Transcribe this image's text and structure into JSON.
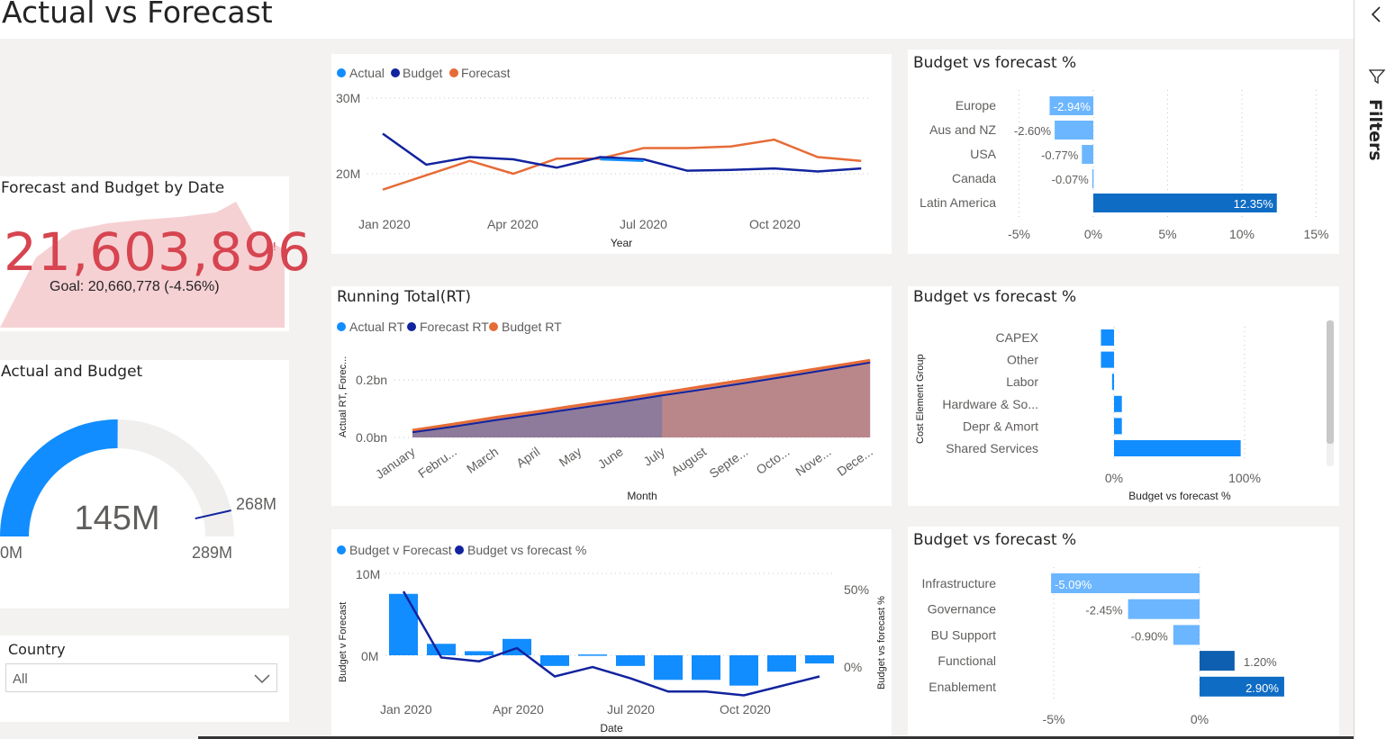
{
  "page_title": "Actual vs Forecast",
  "filters_label": "Filters",
  "icons": {
    "collapse": "chevron-left-icon",
    "filter": "filter-funnel-icon",
    "dropdown": "chevron-down-icon"
  },
  "colors": {
    "actual": "#118dff",
    "budget": "#12239e",
    "forecast": "#e66c37",
    "light_bar": "#6cb6ff",
    "dark_bar": "#0f6cc4",
    "kpi_red": "#d64550"
  },
  "kpi": {
    "title": "Forecast and Budget by Date",
    "value": "21,603,896",
    "indicator": "!",
    "goal": "Goal: 20,660,778 (-4.56%)"
  },
  "gauge": {
    "title": "Actual and Budget",
    "value_label": "145M",
    "min_label": "0M",
    "max_label": "289M",
    "target_label": "268M",
    "chart_data": {
      "type": "gauge",
      "value": 145,
      "min": 0,
      "max": 289,
      "target": 268,
      "unit": "M"
    }
  },
  "slicer": {
    "title": "Country",
    "value": "All"
  },
  "line_chart": {
    "legend": [
      "Actual",
      "Budget",
      "Forecast"
    ],
    "xlabel": "Year",
    "y_ticks": [
      "30M",
      "20M"
    ],
    "x_ticks": [
      "Jan 2020",
      "Apr 2020",
      "Jul 2020",
      "Oct 2020"
    ],
    "chart_data": {
      "type": "line",
      "x": [
        "2020-01",
        "2020-02",
        "2020-03",
        "2020-04",
        "2020-05",
        "2020-06",
        "2020-07",
        "2020-08",
        "2020-09",
        "2020-10",
        "2020-11",
        "2020-12"
      ],
      "ylim": [
        15,
        30
      ],
      "series": [
        {
          "name": "Actual",
          "values": [
            null,
            null,
            null,
            null,
            null,
            21.9,
            21.7,
            null,
            null,
            null,
            null,
            null
          ]
        },
        {
          "name": "Budget",
          "values": [
            25.3,
            21.2,
            22.2,
            21.9,
            20.8,
            22.2,
            21.9,
            20.4,
            20.5,
            20.7,
            20.3,
            20.7
          ]
        },
        {
          "name": "Forecast",
          "values": [
            17.9,
            19.8,
            21.7,
            20.0,
            22.0,
            22.0,
            23.4,
            23.4,
            23.6,
            24.5,
            22.2,
            21.7
          ]
        }
      ]
    }
  },
  "running_total": {
    "title": "Running Total(RT)",
    "legend": [
      "Actual RT",
      "Forecast RT",
      "Budget RT"
    ],
    "xlabel": "Month",
    "ylabel": "Actual RT, Forec...",
    "y_ticks": [
      "0.2bn",
      "0.0bn"
    ],
    "x_ticks": [
      "January",
      "Febru...",
      "March",
      "April",
      "May",
      "June",
      "July",
      "August",
      "Septe...",
      "Octo...",
      "Nove...",
      "Dece..."
    ],
    "chart_data": {
      "type": "area",
      "categories": [
        "January",
        "February",
        "March",
        "April",
        "May",
        "June",
        "July",
        "August",
        "September",
        "October",
        "November",
        "December"
      ],
      "ylim": [
        0,
        0.3
      ],
      "series": [
        {
          "name": "Actual RT",
          "values": [
            0.02,
            0.04,
            0.06,
            0.08,
            0.1,
            0.12,
            0.145,
            null,
            null,
            null,
            null,
            null
          ]
        },
        {
          "name": "Forecast RT",
          "values": [
            0.018,
            0.038,
            0.06,
            0.081,
            0.102,
            0.123,
            0.146,
            0.167,
            0.189,
            0.212,
            0.236,
            0.26
          ]
        },
        {
          "name": "Budget RT",
          "values": [
            0.025,
            0.047,
            0.07,
            0.09,
            0.112,
            0.133,
            0.155,
            0.178,
            0.2,
            0.222,
            0.245,
            0.268
          ]
        }
      ]
    }
  },
  "combo_chart": {
    "legend": [
      "Budget v Forecast",
      "Budget vs forecast %"
    ],
    "xlabel": "Date",
    "ylabel_left": "Budget v Forecast",
    "ylabel_right": "Budget vs forecast %",
    "y_ticks_left": [
      "10M",
      "0M"
    ],
    "y_ticks_right": [
      "50%",
      "0%"
    ],
    "x_ticks": [
      "Jan 2020",
      "Apr 2020",
      "Jul 2020",
      "Oct 2020"
    ],
    "chart_data": {
      "type": "bar",
      "x": [
        "2020-01",
        "2020-02",
        "2020-03",
        "2020-04",
        "2020-05",
        "2020-06",
        "2020-07",
        "2020-08",
        "2020-09",
        "2020-10",
        "2020-11",
        "2020-12"
      ],
      "series": [
        {
          "name": "Budget v Forecast",
          "values": [
            7.5,
            1.4,
            0.5,
            2.0,
            -1.3,
            0.1,
            -1.3,
            -3.0,
            -3.0,
            -3.7,
            -2.0,
            -1.0
          ]
        },
        {
          "name": "Budget vs forecast %",
          "values": [
            40,
            5,
            3,
            10,
            -5,
            0,
            -6,
            -13,
            -13,
            -15,
            -10,
            -5
          ]
        }
      ]
    }
  },
  "bar_region": {
    "title": "Budget vs forecast %",
    "categories": [
      "Europe",
      "Aus and NZ",
      "USA",
      "Canada",
      "Latin America"
    ],
    "labels": [
      "-2.94%",
      "-2.60%",
      "-0.77%",
      "-0.07%",
      "12.35%"
    ],
    "x_ticks": [
      "-5%",
      "0%",
      "5%",
      "10%",
      "15%"
    ],
    "chart_data": {
      "type": "bar",
      "orientation": "horizontal",
      "categories": [
        "Europe",
        "Aus and NZ",
        "USA",
        "Canada",
        "Latin America"
      ],
      "values": [
        -2.94,
        -2.6,
        -0.77,
        -0.07,
        12.35
      ],
      "xlim": [
        -5,
        15
      ]
    }
  },
  "bar_cost": {
    "title": "Budget vs forecast %",
    "ylabel": "Cost Element Group",
    "xlabel": "Budget vs forecast %",
    "categories": [
      "CAPEX",
      "Other",
      "Labor",
      "Hardware & So...",
      "Depr & Amort",
      "Shared Services"
    ],
    "x_ticks": [
      "0%",
      "100%"
    ],
    "chart_data": {
      "type": "bar",
      "orientation": "horizontal",
      "categories": [
        "CAPEX",
        "Other",
        "Labor",
        "Hardware & So...",
        "Depr & Amort",
        "Shared Services"
      ],
      "values": [
        -10,
        -10,
        -1.5,
        6,
        6,
        97
      ],
      "xlim": [
        -20,
        120
      ]
    }
  },
  "bar_bu": {
    "title": "Budget vs forecast %",
    "categories": [
      "Infrastructure",
      "Governance",
      "BU Support",
      "Functional",
      "Enablement"
    ],
    "labels": [
      "-5.09%",
      "-2.45%",
      "-0.90%",
      "1.20%",
      "2.90%"
    ],
    "x_ticks": [
      "-5%",
      "0%"
    ],
    "chart_data": {
      "type": "bar",
      "orientation": "horizontal",
      "categories": [
        "Infrastructure",
        "Governance",
        "BU Support",
        "Functional",
        "Enablement"
      ],
      "values": [
        -5.09,
        -2.45,
        -0.9,
        1.2,
        2.9
      ],
      "xlim": [
        -5.2,
        4
      ]
    }
  }
}
